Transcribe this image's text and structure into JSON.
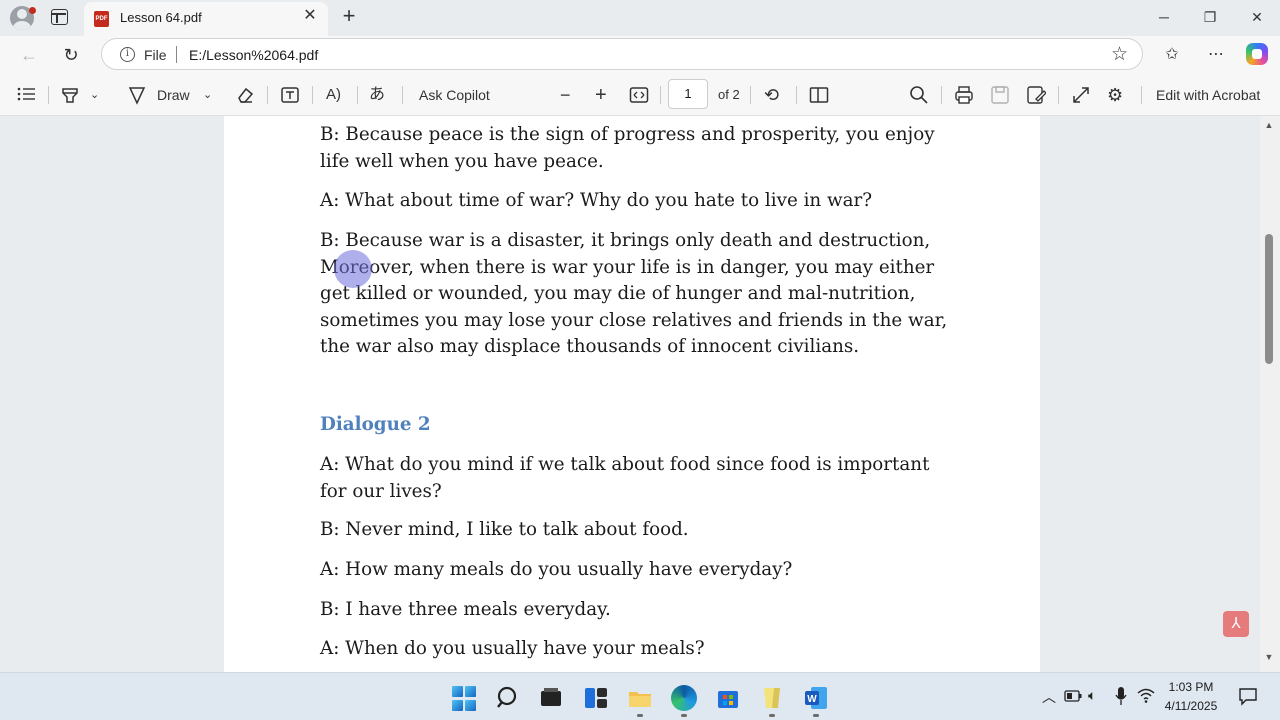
{
  "browser": {
    "tab_title": "Lesson 64.pdf",
    "pdf_favicon_text": "PDF",
    "address_scheme": "File",
    "address_url": "E:/Lesson%2064.pdf"
  },
  "toolbar": {
    "draw_label": "Draw",
    "ask_copilot_label": "Ask Copilot",
    "current_page": "1",
    "page_count_label": "of 2",
    "edit_acrobat_label": "Edit with Acrobat"
  },
  "document": {
    "para1": "B: Because peace is the sign of progress and prosperity, you enjoy life well when you have peace.",
    "para2": "A: What about time of war? Why do you hate to live in war?",
    "para3": "B: Because war is a disaster, it brings only death and destruction, Moreover, when there is war your life is in danger, you may either get killed or wounded, you may die of hunger and mal-nutrition, sometimes  you may lose your close relatives and friends in the war, the war also may displace thousands of innocent civilians.",
    "heading": "Dialogue 2",
    "para4": "A: What do you mind if we talk about food since food is important for our lives?",
    "para5": "B: Never mind, I like to talk about food.",
    "para6": "A: How many meals do you usually have everyday?",
    "para7": "B: I have three meals everyday.",
    "para8": "A: When do you usually have your meals?"
  },
  "taskbar": {
    "time": "1:03 PM",
    "date": "4/11/2025"
  },
  "icons": [
    "profile-icon",
    "tab-actions-icon",
    "pdf-icon",
    "close-icon",
    "new-tab-icon",
    "minimize-icon",
    "restore-icon",
    "window-close-icon",
    "back-icon",
    "refresh-icon",
    "info-icon",
    "favorite-star-icon",
    "favorites-icon",
    "more-icon",
    "copilot-icon",
    "contents-icon",
    "highlight-icon",
    "draw-icon",
    "eraser-icon",
    "text-icon",
    "read-aloud-icon",
    "translate-icon",
    "zoom-out-icon",
    "zoom-in-icon",
    "fit-page-icon",
    "rotate-icon",
    "page-view-icon",
    "search-icon",
    "print-icon",
    "save-icon",
    "save-as-icon",
    "fullscreen-icon",
    "settings-icon",
    "acrobat-icon",
    "start-icon",
    "taskbar-search-icon",
    "file-explorer-icon",
    "widgets-icon",
    "folder-icon",
    "edge-icon",
    "store-icon",
    "notes-icon",
    "word-icon",
    "chevron-up-icon",
    "battery-icon",
    "volume-icon",
    "microphone-icon",
    "network-icon",
    "notification-icon"
  ]
}
